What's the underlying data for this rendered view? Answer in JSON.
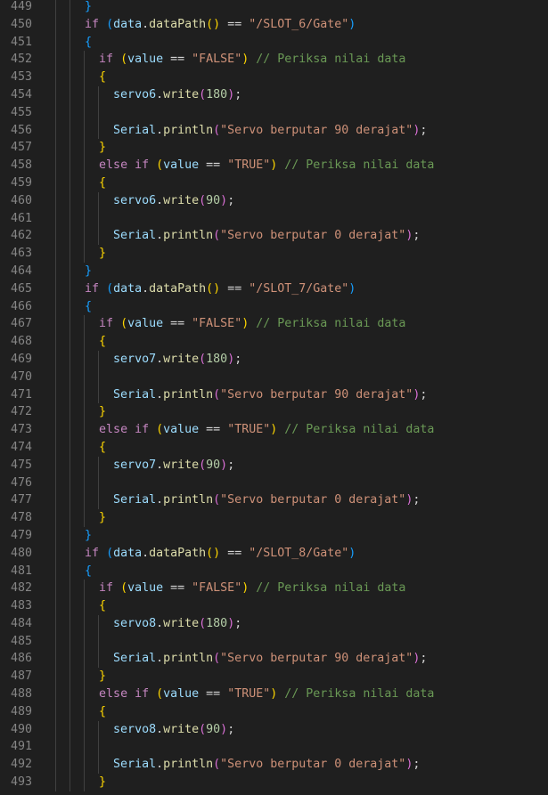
{
  "editor": {
    "lines": [
      {
        "n": "449",
        "t": [
          [
            "sp",
            "    "
          ],
          [
            "b3",
            "}"
          ]
        ]
      },
      {
        "n": "450",
        "t": [
          [
            "sp",
            "    "
          ],
          [
            "kw",
            "if"
          ],
          [
            "op",
            " "
          ],
          [
            "b3",
            "("
          ],
          [
            "var",
            "data"
          ],
          [
            "op",
            "."
          ],
          [
            "fn",
            "dataPath"
          ],
          [
            "b1",
            "()"
          ],
          [
            "op",
            " == "
          ],
          [
            "str",
            "\"/SLOT_6/Gate\""
          ],
          [
            "b3",
            ")"
          ]
        ]
      },
      {
        "n": "451",
        "t": [
          [
            "sp",
            "    "
          ],
          [
            "b3",
            "{"
          ]
        ]
      },
      {
        "n": "452",
        "t": [
          [
            "sp",
            "      "
          ],
          [
            "kw",
            "if"
          ],
          [
            "op",
            " "
          ],
          [
            "b1",
            "("
          ],
          [
            "var",
            "value"
          ],
          [
            "op",
            " == "
          ],
          [
            "str",
            "\"FALSE\""
          ],
          [
            "b1",
            ")"
          ],
          [
            "op",
            " "
          ],
          [
            "cmt",
            "// Periksa nilai data"
          ]
        ]
      },
      {
        "n": "453",
        "t": [
          [
            "sp",
            "      "
          ],
          [
            "b1",
            "{"
          ]
        ]
      },
      {
        "n": "454",
        "t": [
          [
            "sp",
            "        "
          ],
          [
            "var",
            "servo6"
          ],
          [
            "op",
            "."
          ],
          [
            "fn",
            "write"
          ],
          [
            "b2",
            "("
          ],
          [
            "num",
            "180"
          ],
          [
            "b2",
            ")"
          ],
          [
            "op",
            ";"
          ]
        ]
      },
      {
        "n": "455",
        "t": []
      },
      {
        "n": "456",
        "t": [
          [
            "sp",
            "        "
          ],
          [
            "var",
            "Serial"
          ],
          [
            "op",
            "."
          ],
          [
            "fn",
            "println"
          ],
          [
            "b2",
            "("
          ],
          [
            "str",
            "\"Servo berputar 90 derajat\""
          ],
          [
            "b2",
            ")"
          ],
          [
            "op",
            ";"
          ]
        ]
      },
      {
        "n": "457",
        "t": [
          [
            "sp",
            "      "
          ],
          [
            "b1",
            "}"
          ]
        ]
      },
      {
        "n": "458",
        "t": [
          [
            "sp",
            "      "
          ],
          [
            "kw",
            "else"
          ],
          [
            "op",
            " "
          ],
          [
            "kw",
            "if"
          ],
          [
            "op",
            " "
          ],
          [
            "b1",
            "("
          ],
          [
            "var",
            "value"
          ],
          [
            "op",
            " == "
          ],
          [
            "str",
            "\"TRUE\""
          ],
          [
            "b1",
            ")"
          ],
          [
            "op",
            " "
          ],
          [
            "cmt",
            "// Periksa nilai data"
          ]
        ]
      },
      {
        "n": "459",
        "t": [
          [
            "sp",
            "      "
          ],
          [
            "b1",
            "{"
          ]
        ]
      },
      {
        "n": "460",
        "t": [
          [
            "sp",
            "        "
          ],
          [
            "var",
            "servo6"
          ],
          [
            "op",
            "."
          ],
          [
            "fn",
            "write"
          ],
          [
            "b2",
            "("
          ],
          [
            "num",
            "90"
          ],
          [
            "b2",
            ")"
          ],
          [
            "op",
            ";"
          ]
        ]
      },
      {
        "n": "461",
        "t": []
      },
      {
        "n": "462",
        "t": [
          [
            "sp",
            "        "
          ],
          [
            "var",
            "Serial"
          ],
          [
            "op",
            "."
          ],
          [
            "fn",
            "println"
          ],
          [
            "b2",
            "("
          ],
          [
            "str",
            "\"Servo berputar 0 derajat\""
          ],
          [
            "b2",
            ")"
          ],
          [
            "op",
            ";"
          ]
        ]
      },
      {
        "n": "463",
        "t": [
          [
            "sp",
            "      "
          ],
          [
            "b1",
            "}"
          ]
        ]
      },
      {
        "n": "464",
        "t": [
          [
            "sp",
            "    "
          ],
          [
            "b3",
            "}"
          ]
        ]
      },
      {
        "n": "465",
        "t": [
          [
            "sp",
            "    "
          ],
          [
            "kw",
            "if"
          ],
          [
            "op",
            " "
          ],
          [
            "b3",
            "("
          ],
          [
            "var",
            "data"
          ],
          [
            "op",
            "."
          ],
          [
            "fn",
            "dataPath"
          ],
          [
            "b1",
            "()"
          ],
          [
            "op",
            " == "
          ],
          [
            "str",
            "\"/SLOT_7/Gate\""
          ],
          [
            "b3",
            ")"
          ]
        ]
      },
      {
        "n": "466",
        "t": [
          [
            "sp",
            "    "
          ],
          [
            "b3",
            "{"
          ]
        ]
      },
      {
        "n": "467",
        "t": [
          [
            "sp",
            "      "
          ],
          [
            "kw",
            "if"
          ],
          [
            "op",
            " "
          ],
          [
            "b1",
            "("
          ],
          [
            "var",
            "value"
          ],
          [
            "op",
            " == "
          ],
          [
            "str",
            "\"FALSE\""
          ],
          [
            "b1",
            ")"
          ],
          [
            "op",
            " "
          ],
          [
            "cmt",
            "// Periksa nilai data"
          ]
        ]
      },
      {
        "n": "468",
        "t": [
          [
            "sp",
            "      "
          ],
          [
            "b1",
            "{"
          ]
        ]
      },
      {
        "n": "469",
        "t": [
          [
            "sp",
            "        "
          ],
          [
            "var",
            "servo7"
          ],
          [
            "op",
            "."
          ],
          [
            "fn",
            "write"
          ],
          [
            "b2",
            "("
          ],
          [
            "num",
            "180"
          ],
          [
            "b2",
            ")"
          ],
          [
            "op",
            ";"
          ]
        ]
      },
      {
        "n": "470",
        "t": []
      },
      {
        "n": "471",
        "t": [
          [
            "sp",
            "        "
          ],
          [
            "var",
            "Serial"
          ],
          [
            "op",
            "."
          ],
          [
            "fn",
            "println"
          ],
          [
            "b2",
            "("
          ],
          [
            "str",
            "\"Servo berputar 90 derajat\""
          ],
          [
            "b2",
            ")"
          ],
          [
            "op",
            ";"
          ]
        ]
      },
      {
        "n": "472",
        "t": [
          [
            "sp",
            "      "
          ],
          [
            "b1",
            "}"
          ]
        ]
      },
      {
        "n": "473",
        "t": [
          [
            "sp",
            "      "
          ],
          [
            "kw",
            "else"
          ],
          [
            "op",
            " "
          ],
          [
            "kw",
            "if"
          ],
          [
            "op",
            " "
          ],
          [
            "b1",
            "("
          ],
          [
            "var",
            "value"
          ],
          [
            "op",
            " == "
          ],
          [
            "str",
            "\"TRUE\""
          ],
          [
            "b1",
            ")"
          ],
          [
            "op",
            " "
          ],
          [
            "cmt",
            "// Periksa nilai data"
          ]
        ]
      },
      {
        "n": "474",
        "t": [
          [
            "sp",
            "      "
          ],
          [
            "b1",
            "{"
          ]
        ]
      },
      {
        "n": "475",
        "t": [
          [
            "sp",
            "        "
          ],
          [
            "var",
            "servo7"
          ],
          [
            "op",
            "."
          ],
          [
            "fn",
            "write"
          ],
          [
            "b2",
            "("
          ],
          [
            "num",
            "90"
          ],
          [
            "b2",
            ")"
          ],
          [
            "op",
            ";"
          ]
        ]
      },
      {
        "n": "476",
        "t": []
      },
      {
        "n": "477",
        "t": [
          [
            "sp",
            "        "
          ],
          [
            "var",
            "Serial"
          ],
          [
            "op",
            "."
          ],
          [
            "fn",
            "println"
          ],
          [
            "b2",
            "("
          ],
          [
            "str",
            "\"Servo berputar 0 derajat\""
          ],
          [
            "b2",
            ")"
          ],
          [
            "op",
            ";"
          ]
        ]
      },
      {
        "n": "478",
        "t": [
          [
            "sp",
            "      "
          ],
          [
            "b1",
            "}"
          ]
        ]
      },
      {
        "n": "479",
        "t": [
          [
            "sp",
            "    "
          ],
          [
            "b3",
            "}"
          ]
        ]
      },
      {
        "n": "480",
        "t": [
          [
            "sp",
            "    "
          ],
          [
            "kw",
            "if"
          ],
          [
            "op",
            " "
          ],
          [
            "b3",
            "("
          ],
          [
            "var",
            "data"
          ],
          [
            "op",
            "."
          ],
          [
            "fn",
            "dataPath"
          ],
          [
            "b1",
            "()"
          ],
          [
            "op",
            " == "
          ],
          [
            "str",
            "\"/SLOT_8/Gate\""
          ],
          [
            "b3",
            ")"
          ]
        ]
      },
      {
        "n": "481",
        "t": [
          [
            "sp",
            "    "
          ],
          [
            "b3",
            "{"
          ]
        ]
      },
      {
        "n": "482",
        "t": [
          [
            "sp",
            "      "
          ],
          [
            "kw",
            "if"
          ],
          [
            "op",
            " "
          ],
          [
            "b1",
            "("
          ],
          [
            "var",
            "value"
          ],
          [
            "op",
            " == "
          ],
          [
            "str",
            "\"FALSE\""
          ],
          [
            "b1",
            ")"
          ],
          [
            "op",
            " "
          ],
          [
            "cmt",
            "// Periksa nilai data"
          ]
        ]
      },
      {
        "n": "483",
        "t": [
          [
            "sp",
            "      "
          ],
          [
            "b1",
            "{"
          ]
        ]
      },
      {
        "n": "484",
        "t": [
          [
            "sp",
            "        "
          ],
          [
            "var",
            "servo8"
          ],
          [
            "op",
            "."
          ],
          [
            "fn",
            "write"
          ],
          [
            "b2",
            "("
          ],
          [
            "num",
            "180"
          ],
          [
            "b2",
            ")"
          ],
          [
            "op",
            ";"
          ]
        ]
      },
      {
        "n": "485",
        "t": []
      },
      {
        "n": "486",
        "t": [
          [
            "sp",
            "        "
          ],
          [
            "var",
            "Serial"
          ],
          [
            "op",
            "."
          ],
          [
            "fn",
            "println"
          ],
          [
            "b2",
            "("
          ],
          [
            "str",
            "\"Servo berputar 90 derajat\""
          ],
          [
            "b2",
            ")"
          ],
          [
            "op",
            ";"
          ]
        ]
      },
      {
        "n": "487",
        "t": [
          [
            "sp",
            "      "
          ],
          [
            "b1",
            "}"
          ]
        ]
      },
      {
        "n": "488",
        "t": [
          [
            "sp",
            "      "
          ],
          [
            "kw",
            "else"
          ],
          [
            "op",
            " "
          ],
          [
            "kw",
            "if"
          ],
          [
            "op",
            " "
          ],
          [
            "b1",
            "("
          ],
          [
            "var",
            "value"
          ],
          [
            "op",
            " == "
          ],
          [
            "str",
            "\"TRUE\""
          ],
          [
            "b1",
            ")"
          ],
          [
            "op",
            " "
          ],
          [
            "cmt",
            "// Periksa nilai data"
          ]
        ]
      },
      {
        "n": "489",
        "t": [
          [
            "sp",
            "      "
          ],
          [
            "b1",
            "{"
          ]
        ]
      },
      {
        "n": "490",
        "t": [
          [
            "sp",
            "        "
          ],
          [
            "var",
            "servo8"
          ],
          [
            "op",
            "."
          ],
          [
            "fn",
            "write"
          ],
          [
            "b2",
            "("
          ],
          [
            "num",
            "90"
          ],
          [
            "b2",
            ")"
          ],
          [
            "op",
            ";"
          ]
        ]
      },
      {
        "n": "491",
        "t": []
      },
      {
        "n": "492",
        "t": [
          [
            "sp",
            "        "
          ],
          [
            "var",
            "Serial"
          ],
          [
            "op",
            "."
          ],
          [
            "fn",
            "println"
          ],
          [
            "b2",
            "("
          ],
          [
            "str",
            "\"Servo berputar 0 derajat\""
          ],
          [
            "b2",
            ")"
          ],
          [
            "op",
            ";"
          ]
        ]
      },
      {
        "n": "493",
        "t": [
          [
            "sp",
            "      "
          ],
          [
            "b1",
            "}"
          ]
        ]
      }
    ]
  }
}
